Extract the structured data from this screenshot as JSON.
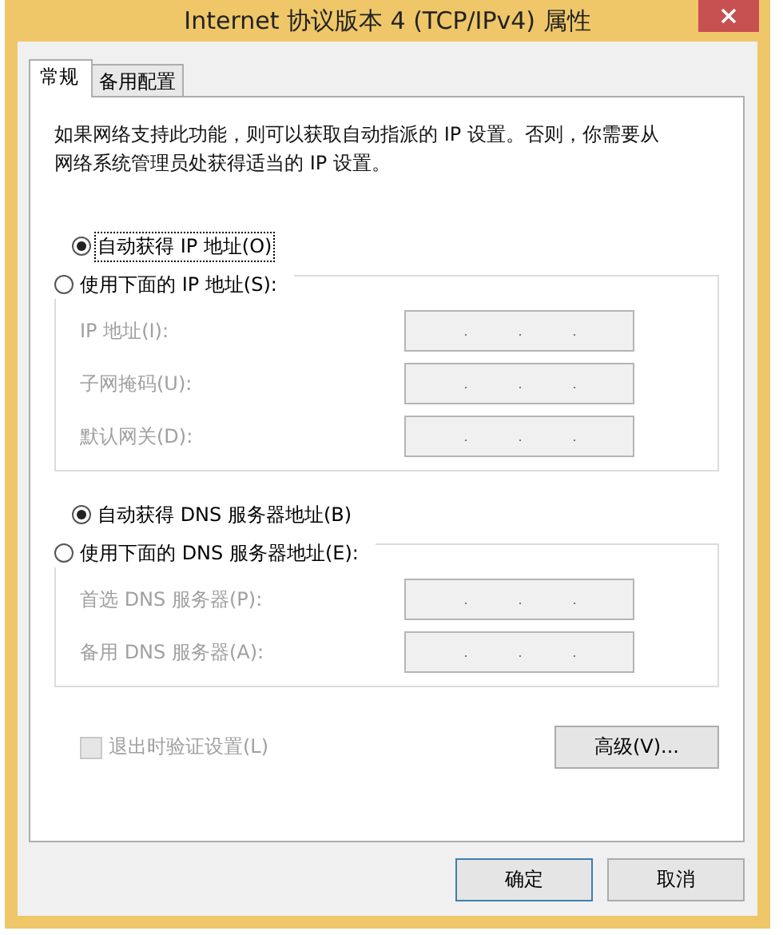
{
  "window": {
    "title": "Internet 协议版本 4 (TCP/IPv4) 属性"
  },
  "tabs": [
    {
      "label": "常规",
      "selected": true
    },
    {
      "label": "备用配置",
      "selected": false
    }
  ],
  "description": "如果网络支持此功能，则可以获取自动指派的 IP 设置。否则，你需要从网络系统管理员处获得适当的 IP 设置。",
  "sections": [
    {
      "auto_option": {
        "label": "自动获得 IP 地址(O)",
        "selected": true,
        "focused": true
      },
      "manual_option": {
        "label": "使用下面的 IP 地址(S):",
        "selected": false
      },
      "disabled": true,
      "fields": [
        {
          "label": "IP 地址(I):"
        },
        {
          "label": "子网掩码(U):"
        },
        {
          "label": "默认网关(D):"
        }
      ]
    },
    {
      "auto_option": {
        "label": "自动获得 DNS 服务器地址(B)",
        "selected": true,
        "focused": false
      },
      "manual_option": {
        "label": "使用下面的 DNS 服务器地址(E):",
        "selected": false
      },
      "disabled": true,
      "fields": [
        {
          "label": "首选 DNS 服务器(P):"
        },
        {
          "label": "备用 DNS 服务器(A):"
        }
      ]
    }
  ],
  "validate_checkbox": {
    "label": "退出时验证设置(L)",
    "checked": false,
    "disabled": true
  },
  "advanced_button": "高级(V)...",
  "buttons": [
    "确定",
    "取消"
  ]
}
